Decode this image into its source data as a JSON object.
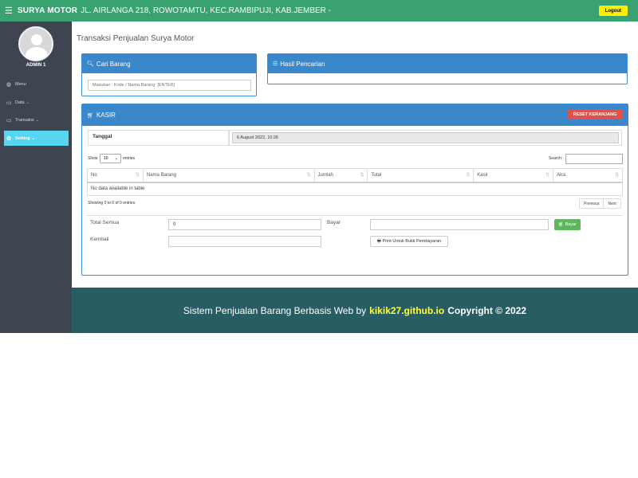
{
  "topbar": {
    "brand": "SURYA MOTOR",
    "address": "JL. AIRLANGA 218, ROWOTAMTU, KEC.RAMBIPUJI, KAB.JEMBER -",
    "logout_label": "Logout"
  },
  "sidebar": {
    "user_name": "ADMIN 1",
    "items": [
      {
        "label": "Menu",
        "icon": "dashboard-icon"
      },
      {
        "label": "Data",
        "icon": "desktop-icon"
      },
      {
        "label": "Transaksi",
        "icon": "desktop-icon"
      },
      {
        "label": "Setting",
        "icon": "gear-icon",
        "active": true
      }
    ]
  },
  "main": {
    "page_title": "Transaksi Penjualan Surya Motor",
    "cari_panel": {
      "title": "Cari Barang",
      "search_placeholder": "Masukan : Kode / Nama Barang  [ENTER]"
    },
    "hasil_panel": {
      "title": "Hasil Pencarian"
    },
    "kasir_panel": {
      "title": "KASIR",
      "reset_label": "RESET KERANJANG",
      "tanggal_label": "Tanggal",
      "tanggal_value": "6 August 2022, 10:26",
      "show_label": "Show",
      "entries_value": "10",
      "entries_label": "entries",
      "search_label": "Search:",
      "columns": [
        "No",
        "Nama Barang",
        "Jumlah",
        "Total",
        "Kasir",
        "Aksi"
      ],
      "empty_text": "No data available in table",
      "showing_text": "Showing 0 to 0 of 0 entries",
      "previous_label": "Previous",
      "next_label": "Next",
      "total_semua_label": "Total Semua",
      "total_semua_value": "0",
      "bayar_label": "Bayar",
      "bayar_button": "Bayar",
      "kembali_label": "Kembali",
      "print_label": "Print Untuk Bukti Pembayaran"
    }
  },
  "footer": {
    "text": "Sistem Penjualan Barang Berbasis Web by",
    "link": "kikik27.github.io",
    "copyright": "Copyright © 2022"
  },
  "colors": {
    "topbar": "#3aa171",
    "sidebar": "#3f4451",
    "active_nav": "#57d6f2",
    "panel_blue": "#3a87cc",
    "reset_red": "#d9534f",
    "bayar_green": "#5cb85c",
    "footer": "#285e63",
    "footer_link": "#ffff33",
    "logout_yellow": "#ffee00"
  }
}
